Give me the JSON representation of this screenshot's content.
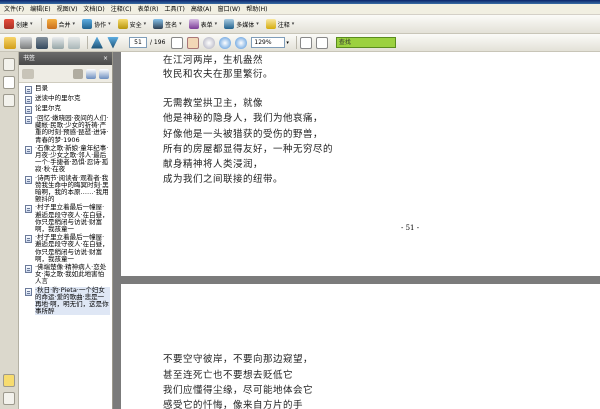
{
  "menu": [
    "文件(F)",
    "编辑(E)",
    "视图(V)",
    "文档(D)",
    "注释(C)",
    "表单(R)",
    "工具(T)",
    "高级(A)",
    "窗口(W)",
    "帮助(H)"
  ],
  "toolbar": {
    "create": "创建",
    "combine": "合并",
    "collaborate": "协作",
    "secure": "安全",
    "sign": "签名",
    "forms": "表单",
    "multimedia": "多媒体",
    "comment": "注释"
  },
  "nav": {
    "page_current": "51",
    "page_total": "/ 196",
    "zoom": "129%",
    "find": "查找"
  },
  "bookmarks": {
    "header": "书签",
    "close": "×",
    "items": [
      "目录",
      "送读中的里尔克",
      "论里尔克",
      "·回忆·嫩晓园·夜间的人们·藏帐·民歌·少女的祈祷·严重的时刻·预感·琵琶·进诗·青春的梦·1906",
      "·石像之歌·新娘·童年纪事·月夜·少女之歌·邻人·最后一个·手捷者·恐惧·忍诗·孤寂·秋·在夜",
      "·诗两节·阅读者·观看者·我赞我生命中的晦冥时刻·黑暗啊，我的本原……·我用颤抖的",
      "·村子里立着最后一幢屋·邂逅是段守夜人·在白昼，你只是稍闭与访说·财富啊，我孩童一",
      "·村子里立着最后一幢屋·邂逅是段守夜人·在白昼，你只是稍闭与访说·财富啊，我孩童一",
      "·佛端楚像·精神病人·恋处女·海之歌·我如此地害怕人言",
      "·秋日·豹·Pieta·一个妇女的命运·爱的歌曲·悲是一再地·啊，明无们，这是你事所醉"
    ]
  },
  "page1_lines": [
    "在江河两岸，生机盎然",
    "牧民和农夫在那里繁衍。",
    "无需教堂拱卫主，就像",
    "他是神秘的隐身人，我们为他哀痛，",
    "好像他是一头被猎获的受伤的野兽，",
    "所有的房屋都显得友好，一种无穷尽的",
    "献身精神将人类浸润，",
    "成为我们之间联接的纽带。"
  ],
  "page1_number": "- 51 -",
  "page2_lines": [
    "不要空守彼岸，不要向那边窥望，",
    "甚至连死亡也不要想去贬低它",
    "我们应懂得尘缘，尽可能地体会它",
    "感受它的忏悔，像来自方片的手"
  ],
  "colors": {
    "find_bg": "#9bd13f",
    "viewer_bg": "#7b7b7b",
    "bookmark_header": "#4a4a4a"
  }
}
